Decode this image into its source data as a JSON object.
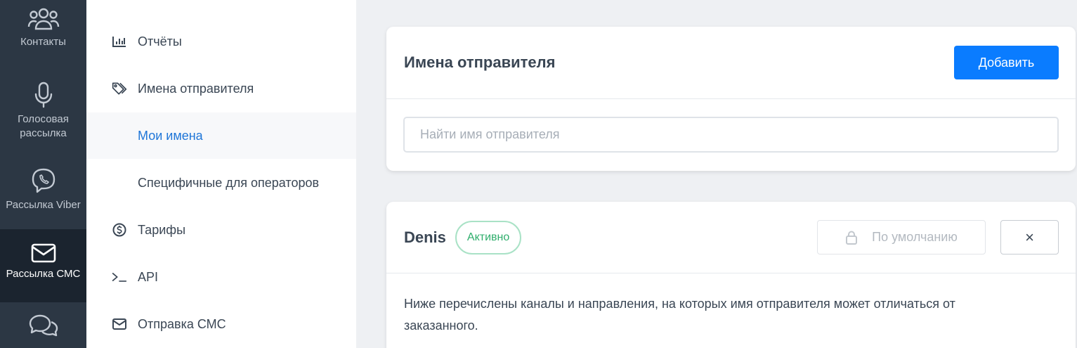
{
  "rail": {
    "items": [
      {
        "label": "Контакты",
        "icon": "users-icon"
      },
      {
        "label": "Голосовая рассылка",
        "icon": "microphone-icon"
      },
      {
        "label": "Рассылка Viber",
        "icon": "viber-icon"
      },
      {
        "label": "Рассылка СМС",
        "icon": "envelope-icon",
        "active": true
      },
      {
        "label": "",
        "icon": "chat-bubbles-icon"
      }
    ]
  },
  "subnav": {
    "items": [
      {
        "label": "Отчёты",
        "icon": "bar-chart-icon"
      },
      {
        "label": "Имена отправителя",
        "icon": "tags-icon"
      },
      {
        "label": "Мои имена",
        "active": true
      },
      {
        "label": "Специфичные для операторов"
      },
      {
        "label": "Тарифы",
        "icon": "dollar-circle-icon"
      },
      {
        "label": "API",
        "icon": "terminal-icon"
      },
      {
        "label": "Отправка СМС",
        "icon": "envelope-icon"
      }
    ]
  },
  "senders_panel": {
    "title": "Имена отправителя",
    "add_button": "Добавить",
    "search_placeholder": "Найти имя отправителя",
    "search_value": ""
  },
  "sender_card": {
    "name": "Denis",
    "status": "Активно",
    "default_button": "По умолчанию",
    "close_symbol": "×",
    "description": "Ниже перечислены каналы и направления, на которых имя отправителя может отличаться от заказанного."
  },
  "colors": {
    "rail_bg": "#2c3744",
    "rail_active": "#1b242f",
    "accent": "#0a7cff",
    "link": "#1f76d8",
    "status_green": "#2fae6c"
  }
}
